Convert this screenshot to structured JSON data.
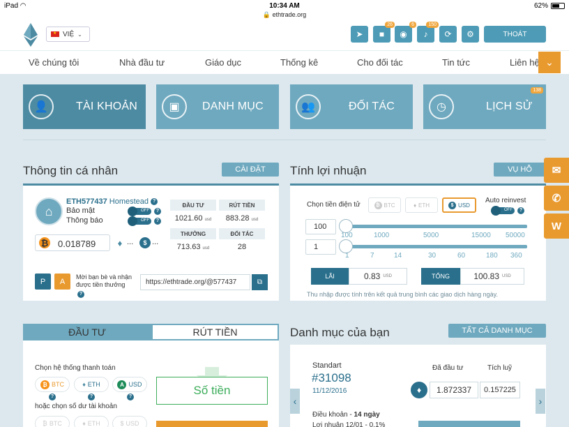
{
  "status_bar": {
    "device": "iPad",
    "time": "10:34 AM",
    "url": "ethtrade.org",
    "battery": "62%"
  },
  "header": {
    "language": "VIỆ",
    "badges": {
      "video": "26",
      "rss": "6",
      "bell": "150"
    },
    "logout": "THOÁT"
  },
  "nav": {
    "items": [
      "Về chúng tôi",
      "Nhà đầu tư",
      "Giáo dục",
      "Thống kê",
      "Cho đối tác",
      "Tin tức",
      "Liên hệ"
    ]
  },
  "tiles": [
    {
      "label": "TÀI KHOẢN"
    },
    {
      "label": "DANH MỤC"
    },
    {
      "label": "ĐỐI TÁC"
    },
    {
      "label": "LỊCH SỬ",
      "badge": "138"
    }
  ],
  "personal": {
    "title": "Thông tin cá nhân",
    "settings_btn": "CÀI ĐẶT",
    "account_id": "ETH577437",
    "plan": "Homestead",
    "security_label": "Bảo mật",
    "notify_label": "Thông báo",
    "toggle_off": "OFF",
    "btc_balance": "0.018789",
    "ellipsis": "...",
    "stats": {
      "invest_label": "ĐẦU TƯ",
      "invest_value": "1021.60",
      "withdraw_label": "RÚT TIỀN",
      "withdraw_value": "883.28",
      "bonus_label": "THƯỞNG",
      "bonus_value": "713.63",
      "partner_label": "ĐỐI TÁC",
      "partner_value": "28",
      "unit": "usd"
    },
    "p_btn": "P",
    "a_btn": "A",
    "refer_text": "Mời bạn bè và nhận được tiền thưởng",
    "refer_link": "https://ethtrade.org/@577437"
  },
  "profit": {
    "title": "Tính lợi nhuận",
    "help_btn": "VỤ HỖ",
    "choose_label": "Chọn tiền điện tử",
    "currencies": [
      "BTC",
      "ETH",
      "USD"
    ],
    "selected_currency": "USD",
    "auto_reinvest": "Auto reinvest",
    "amount_value": "100",
    "days_value": "1",
    "amount_ticks": [
      "100",
      "1000",
      "5000",
      "15000",
      "50000"
    ],
    "days_ticks": [
      "1",
      "7",
      "14",
      "30",
      "60",
      "180",
      "360"
    ],
    "profit_label": "LÃI",
    "profit_value": "0.83",
    "total_label": "TỔNG",
    "total_value": "100.83",
    "unit": "USD",
    "footnote": "Thu nhập được tính trên kết quả trung bình các giao dịch hàng ngày."
  },
  "invest": {
    "tab_invest": "ĐẦU TƯ",
    "tab_withdraw": "RÚT TIỀN",
    "choose_system": "Chọn hệ thống thanh toán",
    "pay_options": [
      "BTC",
      "ETH",
      "USD"
    ],
    "or_balance": "hoặc chọn số dư tài khoản",
    "balance_options": [
      "BTC",
      "ETH",
      "USD"
    ],
    "amount_placeholder": "Số tiền"
  },
  "portfolio": {
    "title": "Danh mục của bạn",
    "all_btn": "TẤT CẢ DANH MỤC",
    "plan": "Standart",
    "number": "#31098",
    "date": "11/12/2016",
    "invested_label": "Đã đầu tư",
    "accumulated_label": "Tích luỹ",
    "invested_value": "1.872337",
    "accumulated_value": "0.157225",
    "terms_label": "Điều khoản - ",
    "terms_value": "14 ngày",
    "profit_partial": "Lợi nhuận 12/01 - 0.1%"
  },
  "colors": {
    "primary": "#4d8ba3",
    "accent": "#e99a2f",
    "light": "#6fa9bf",
    "bg": "#dce8ee"
  }
}
